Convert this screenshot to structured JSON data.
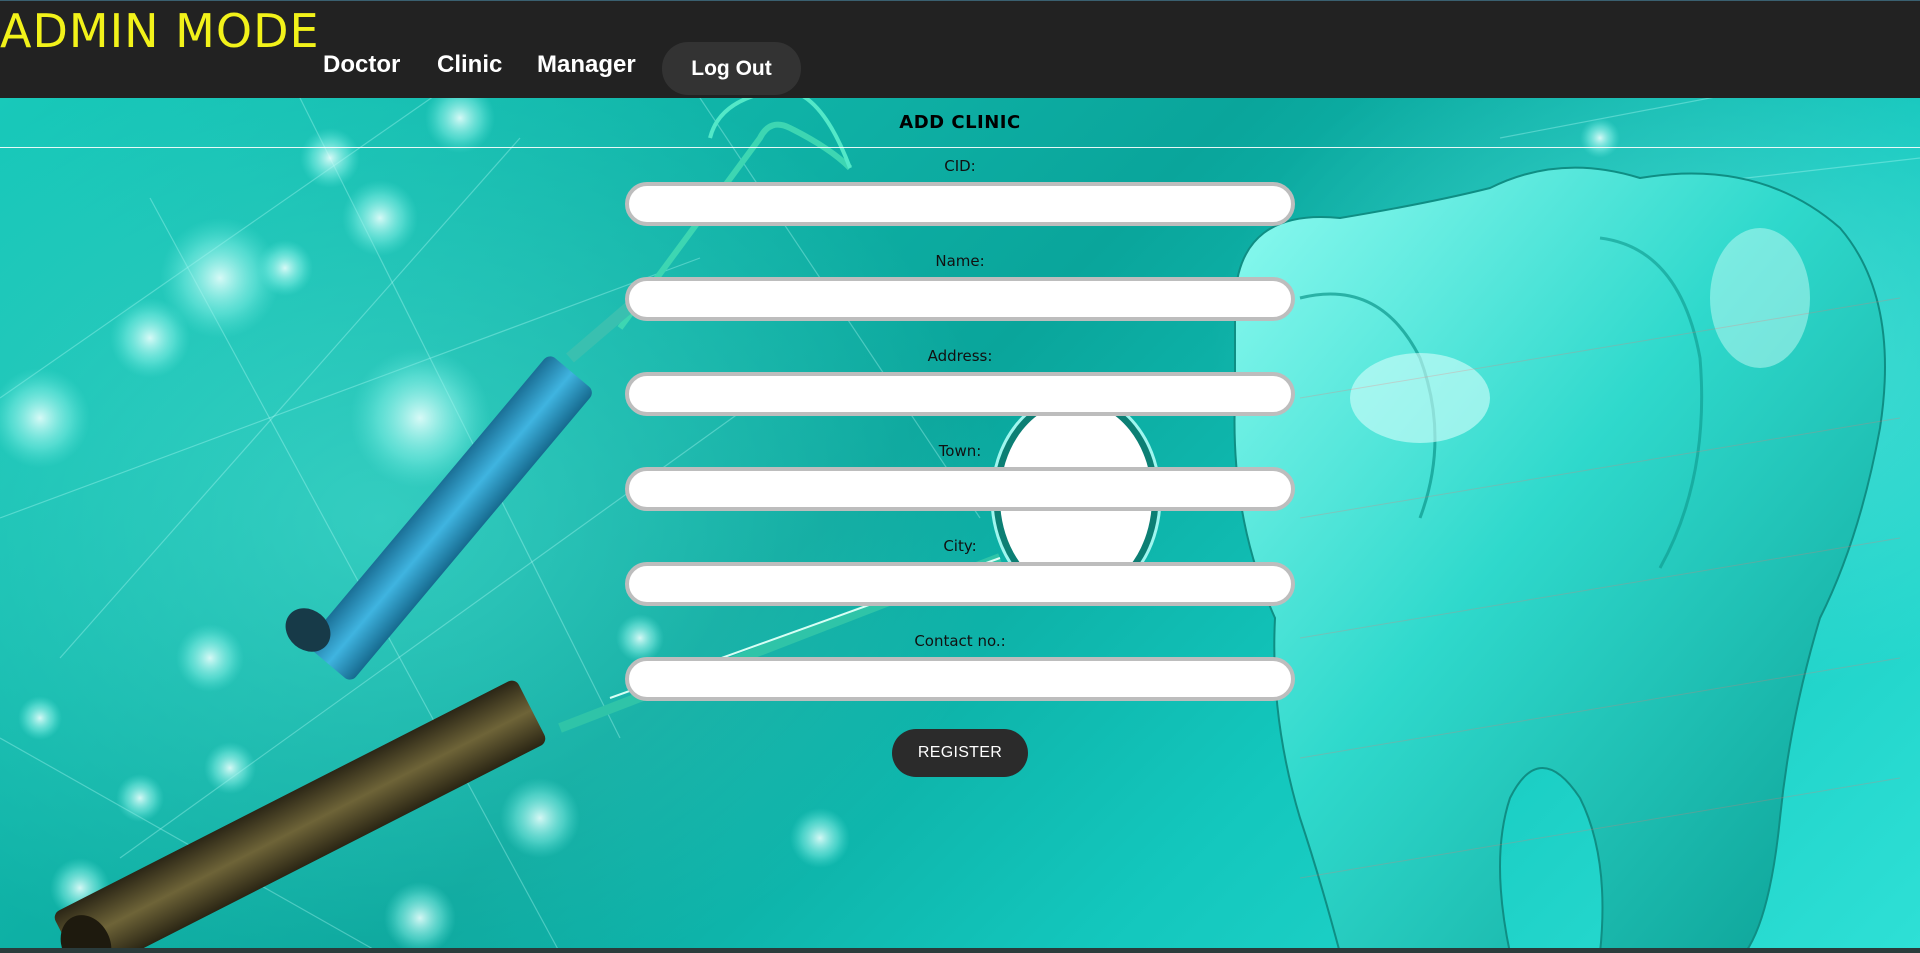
{
  "header": {
    "brand": "ADMIN MODE",
    "nav": [
      {
        "label": "Doctor"
      },
      {
        "label": "Clinic"
      },
      {
        "label": "Manager"
      }
    ],
    "logout_label": "Log Out"
  },
  "form": {
    "title": "ADD CLINIC",
    "fields": [
      {
        "label": "CID:",
        "value": "",
        "placeholder": ""
      },
      {
        "label": "Name:",
        "value": "",
        "placeholder": ""
      },
      {
        "label": "Address:",
        "value": "",
        "placeholder": ""
      },
      {
        "label": "Town:",
        "value": "",
        "placeholder": ""
      },
      {
        "label": "City:",
        "value": "",
        "placeholder": ""
      },
      {
        "label": "Contact no.:",
        "value": "",
        "placeholder": ""
      }
    ],
    "submit_label": "REGISTER"
  },
  "theme": {
    "nav_bg": "#222222",
    "brand_color": "#f2f21a",
    "background_teal": "#0fbfb0",
    "button_bg": "#2b2b2b"
  }
}
